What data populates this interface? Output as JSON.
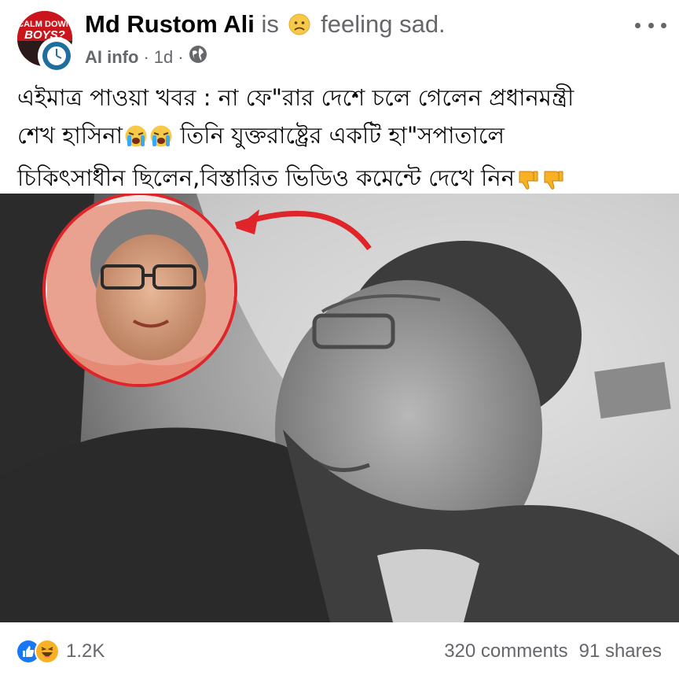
{
  "post": {
    "author": "Md Rustom Ali",
    "is_text": "is",
    "feeling_text": "feeling sad.",
    "feeling_icon": "sad-face-emoji",
    "meta": {
      "label": "AI info",
      "separator": "·",
      "time": "1d",
      "audience_icon": "globe-icon"
    },
    "avatar": {
      "badge_text_line1": "CALM DOWN",
      "badge_text_line2": "BOYS?"
    },
    "text_lines": [
      "এইমাত্র পাওয়া খবর : না ফে\"রার দেশে চলে গেলেন প্রধানমন্ত্রী",
      "শেখ হাসিনা",
      "তিনি যুক্তরাষ্ট্রের একটি হা\"সপাতালে",
      "চিকিৎসাধীন ছিলেন,বিস্তারিত ভিডিও কমেন্টে দেখে নিন"
    ],
    "emojis": {
      "crying": "loudly-crying-emoji",
      "thumbs_down": "thumbs-down-emoji"
    }
  },
  "media": {
    "description_icon": "photo",
    "accent_color": "#e0252a"
  },
  "footer": {
    "reaction_icons": [
      "like-icon",
      "haha-icon"
    ],
    "reaction_count": "1.2K",
    "comments": "320 comments",
    "shares": "91 shares"
  },
  "colors": {
    "text_primary": "#050505",
    "text_secondary": "#65676b",
    "like_blue": "#1877f2",
    "haha_yellow": "#f7b125"
  }
}
